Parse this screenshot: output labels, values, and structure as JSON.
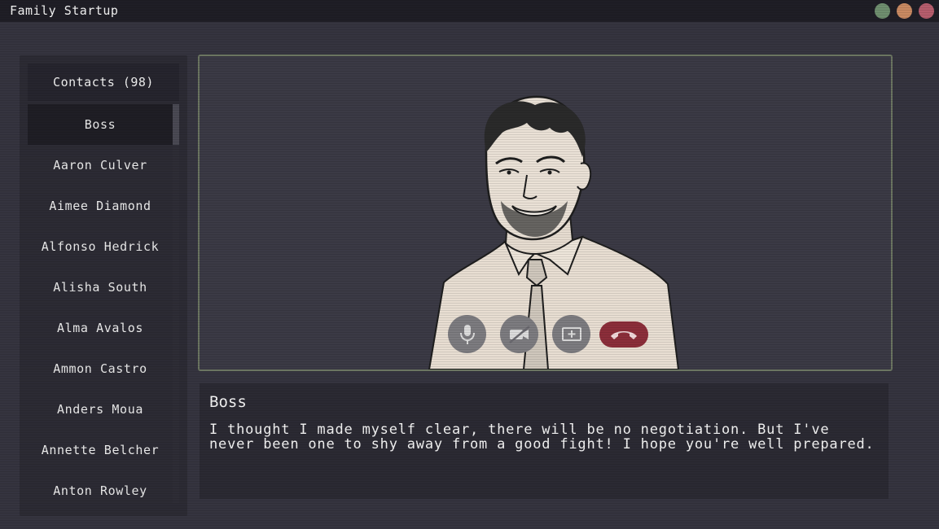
{
  "window": {
    "title": "Family Startup",
    "controls": [
      "minimize",
      "maximize",
      "close"
    ],
    "colors": {
      "minimize": "#6f8f6f",
      "maximize": "#c98a62",
      "close": "#b65d6d"
    }
  },
  "sidebar": {
    "header": "Contacts (98)",
    "contacts": [
      {
        "name": "Boss",
        "active": true
      },
      {
        "name": "Aaron Culver"
      },
      {
        "name": "Aimee Diamond"
      },
      {
        "name": "Alfonso Hedrick"
      },
      {
        "name": "Alisha South"
      },
      {
        "name": "Alma Avalos"
      },
      {
        "name": "Ammon Castro"
      },
      {
        "name": "Anders Moua"
      },
      {
        "name": "Annette Belcher"
      },
      {
        "name": "Anton Rowley"
      }
    ]
  },
  "call": {
    "controls": [
      {
        "name": "mic",
        "icon": "microphone-icon"
      },
      {
        "name": "camera",
        "icon": "camera-off-icon"
      },
      {
        "name": "screen-share",
        "icon": "screen-share-icon"
      },
      {
        "name": "hang-up",
        "icon": "phone-hangup-icon"
      }
    ],
    "accent_hangup": "#8c2e3a"
  },
  "dialog": {
    "speaker": "Boss",
    "text": "I thought I made myself clear, there will be no negotiation. But I've never been one to shy away from a good fight! I hope you're well prepared."
  }
}
